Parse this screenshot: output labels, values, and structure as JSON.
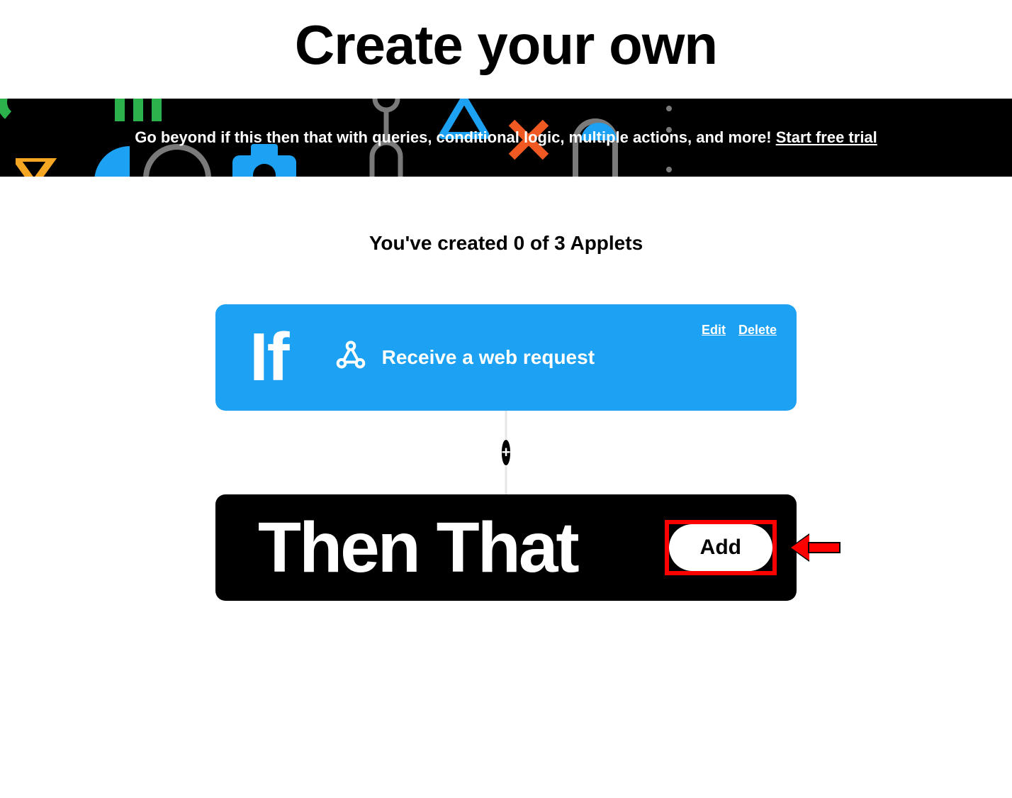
{
  "page": {
    "title": "Create your own",
    "applets_status": "You've created 0 of 3 Applets"
  },
  "promo": {
    "text": "Go beyond if this then that with queries, conditional logic, multiple actions, and more! ",
    "cta": "Start free trial"
  },
  "if_block": {
    "label": "If",
    "trigger": "Receive a web request",
    "service_icon": "webhooks-icon",
    "edit_label": "Edit",
    "delete_label": "Delete"
  },
  "then_block": {
    "label": "Then That",
    "add_label": "Add"
  },
  "colors": {
    "if_bg": "#1da1f2",
    "then_bg": "#000000",
    "highlight": "#ff0000"
  }
}
